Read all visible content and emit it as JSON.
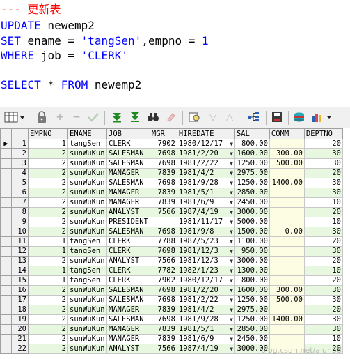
{
  "editor": {
    "comment_prefix": "--- ",
    "comment_text": "更新表",
    "update_kw": "UPDATE",
    "update_table": " newemp2",
    "set_kw": "SET",
    "set_mid1": " ename = ",
    "set_str": "'tangSen'",
    "set_mid2": ",empno = ",
    "set_num": "1",
    "where_kw": "WHERE",
    "where_mid": " job = ",
    "where_str": "'CLERK'",
    "select_kw": "SELECT",
    "select_star": " * ",
    "from_kw": "FROM",
    "select_table": " newemp2"
  },
  "toolbar": {
    "icons": [
      "grid-icon",
      "lock-icon",
      "add-record-icon",
      "delete-record-icon",
      "post-icon",
      "fetch-next-icon",
      "fetch-all-icon",
      "find-icon",
      "clear-icon",
      "query-by-example-icon",
      "filter-icon",
      "sort-icon",
      "tree-icon",
      "save-icon",
      "export-icon",
      "chart-icon"
    ]
  },
  "grid": {
    "columns": [
      "EMPNO",
      "ENAME",
      "JOB",
      "MGR",
      "HIREDATE",
      "SAL",
      "COMM",
      "DEPTNO"
    ],
    "rows": [
      [
        "1",
        "1",
        "tangSen",
        "CLERK",
        "7902",
        "1980/12/17",
        "800.00",
        "",
        "20"
      ],
      [
        "2",
        "2",
        "sunWuKun",
        "SALESMAN",
        "7698",
        "1981/2/20",
        "1600.00",
        "300.00",
        "30"
      ],
      [
        "3",
        "2",
        "sunWuKun",
        "SALESMAN",
        "7698",
        "1981/2/22",
        "1250.00",
        "500.00",
        "30"
      ],
      [
        "4",
        "2",
        "sunWuKun",
        "MANAGER",
        "7839",
        "1981/4/2",
        "2975.00",
        "",
        "20"
      ],
      [
        "5",
        "2",
        "sunWuKun",
        "SALESMAN",
        "7698",
        "1981/9/28",
        "1250.00",
        "1400.00",
        "30"
      ],
      [
        "6",
        "2",
        "sunWuKun",
        "MANAGER",
        "7839",
        "1981/5/1",
        "2850.00",
        "",
        "30"
      ],
      [
        "7",
        "2",
        "sunWuKun",
        "MANAGER",
        "7839",
        "1981/6/9",
        "2450.00",
        "",
        "10"
      ],
      [
        "8",
        "2",
        "sunWuKun",
        "ANALYST",
        "7566",
        "1987/4/19",
        "3000.00",
        "",
        "20"
      ],
      [
        "9",
        "2",
        "sunWuKun",
        "PRESIDENT",
        "",
        "1981/11/17",
        "5000.00",
        "",
        "10"
      ],
      [
        "10",
        "2",
        "sunWuKun",
        "SALESMAN",
        "7698",
        "1981/9/8",
        "1500.00",
        "0.00",
        "30"
      ],
      [
        "11",
        "1",
        "tangSen",
        "CLERK",
        "7788",
        "1987/5/23",
        "1100.00",
        "",
        "20"
      ],
      [
        "12",
        "1",
        "tangSen",
        "CLERK",
        "7698",
        "1981/12/3",
        "950.00",
        "",
        "30"
      ],
      [
        "13",
        "2",
        "sunWuKun",
        "ANALYST",
        "7566",
        "1981/12/3",
        "3000.00",
        "",
        "20"
      ],
      [
        "14",
        "1",
        "tangSen",
        "CLERK",
        "7782",
        "1982/1/23",
        "1300.00",
        "",
        "10"
      ],
      [
        "15",
        "1",
        "tangSen",
        "CLERK",
        "7902",
        "1980/12/17",
        "800.00",
        "",
        "20"
      ],
      [
        "16",
        "2",
        "sunWuKun",
        "SALESMAN",
        "7698",
        "1981/2/20",
        "1600.00",
        "300.00",
        "30"
      ],
      [
        "17",
        "2",
        "sunWuKun",
        "SALESMAN",
        "7698",
        "1981/2/22",
        "1250.00",
        "500.00",
        "30"
      ],
      [
        "18",
        "2",
        "sunWuKun",
        "MANAGER",
        "7839",
        "1981/4/2",
        "2975.00",
        "",
        "20"
      ],
      [
        "19",
        "2",
        "sunWuKun",
        "SALESMAN",
        "7698",
        "1981/9/28",
        "1250.00",
        "1400.00",
        "30"
      ],
      [
        "20",
        "2",
        "sunWuKun",
        "MANAGER",
        "7839",
        "1981/5/1",
        "2850.00",
        "",
        "30"
      ],
      [
        "21",
        "2",
        "sunWuKun",
        "MANAGER",
        "7839",
        "1981/6/9",
        "2450.00",
        "",
        "10"
      ],
      [
        "22",
        "2",
        "sunWuKun",
        "ANALYST",
        "7566",
        "1987/4/19",
        "3000.00",
        "",
        "20"
      ]
    ]
  },
  "watermark": "blog.csdn.net/aiun58"
}
